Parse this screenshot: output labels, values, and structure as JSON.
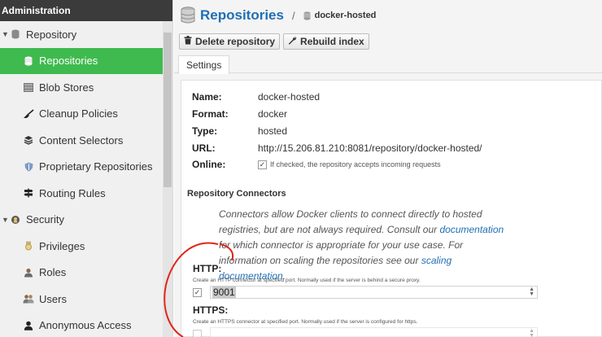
{
  "sidebar": {
    "header": "Administration",
    "items": [
      {
        "label": "Repository",
        "icon": "database-icon"
      },
      {
        "label": "Repositories",
        "icon": "database-icon"
      },
      {
        "label": "Blob Stores",
        "icon": "storage-icon"
      },
      {
        "label": "Cleanup Policies",
        "icon": "broom-icon"
      },
      {
        "label": "Content Selectors",
        "icon": "layers-icon"
      },
      {
        "label": "Proprietary Repositories",
        "icon": "shield-icon"
      },
      {
        "label": "Routing Rules",
        "icon": "signpost-icon"
      },
      {
        "label": "Security",
        "icon": "security-icon"
      },
      {
        "label": "Privileges",
        "icon": "medal-icon"
      },
      {
        "label": "Roles",
        "icon": "user-role-icon"
      },
      {
        "label": "Users",
        "icon": "users-icon"
      },
      {
        "label": "Anonymous Access",
        "icon": "person-icon"
      }
    ]
  },
  "header": {
    "title": "Repositories",
    "separator": "/",
    "breadcrumb": "docker-hosted"
  },
  "toolbar": {
    "delete_label": "Delete repository",
    "rebuild_label": "Rebuild index"
  },
  "tabs": {
    "settings": "Settings"
  },
  "details": {
    "name_label": "Name:",
    "name_value": "docker-hosted",
    "format_label": "Format:",
    "format_value": "docker",
    "type_label": "Type:",
    "type_value": "hosted",
    "url_label": "URL:",
    "url_value": "http://15.206.81.210:8081/repository/docker-hosted/",
    "online_label": "Online:",
    "online_hint": "If checked, the repository accepts incoming requests"
  },
  "connectors": {
    "heading": "Repository Connectors",
    "para_1": "Connectors allow Docker clients to connect directly to hosted registries, but are not always required. Consult our ",
    "link_1": "documentation",
    "para_2": " for which connector is appropriate for your use case. For information on scaling the repositories see our ",
    "link_2": "scaling documentation",
    "para_3": ".",
    "http_label": "HTTP:",
    "http_hint": "Create an HTTP connector at specified port. Normally used if the server is behind a secure proxy.",
    "http_value": "9001",
    "https_label": "HTTPS:",
    "https_hint": "Create an HTTPS connector at specified port. Normally used if the server is configured for https."
  },
  "colors": {
    "accent": "#3fba4f",
    "link": "#1f6fb5",
    "annotation": "#e0261a"
  }
}
